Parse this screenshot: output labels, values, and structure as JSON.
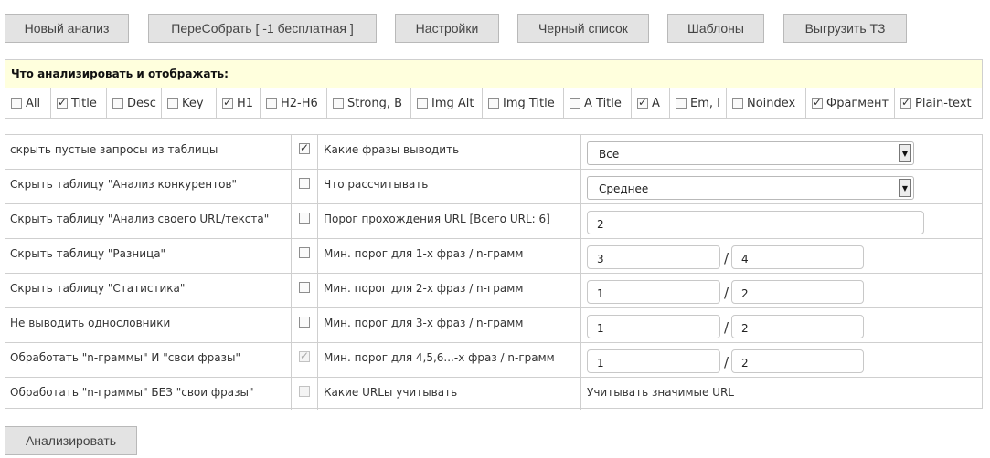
{
  "toolbar": {
    "new_analysis": "Новый анализ",
    "rebuild": "ПереСобрать [ -1 бесплатная ]",
    "settings": "Настройки",
    "blacklist": "Черный список",
    "templates": "Шаблоны",
    "export": "Выгрузить ТЗ"
  },
  "filters": {
    "heading": "Что анализировать и отображать:",
    "items": [
      {
        "label": "All",
        "checked": false
      },
      {
        "label": "Title",
        "checked": true
      },
      {
        "label": "Desc",
        "checked": false
      },
      {
        "label": "Key",
        "checked": false
      },
      {
        "label": "H1",
        "checked": true
      },
      {
        "label": "H2-H6",
        "checked": false
      },
      {
        "label": "Strong, B",
        "checked": false
      },
      {
        "label": "Img Alt",
        "checked": false
      },
      {
        "label": "Img Title",
        "checked": false
      },
      {
        "label": "A Title",
        "checked": false
      },
      {
        "label": "A",
        "checked": true
      },
      {
        "label": "Em, I",
        "checked": false
      },
      {
        "label": "Noindex",
        "checked": false
      },
      {
        "label": "Фрагмент",
        "checked": true
      },
      {
        "label": "Plain-text",
        "checked": true
      }
    ]
  },
  "options": {
    "rows": [
      {
        "label": "скрыть пустые запросы из таблицы",
        "checked": true,
        "disabled": false,
        "setting": "Какие фразы выводить",
        "select": "Все"
      },
      {
        "label": "Скрыть таблицу \"Анализ конкурентов\"",
        "checked": false,
        "disabled": false,
        "setting": "Что рассчитывать",
        "select": "Среднее"
      },
      {
        "label": "Скрыть таблицу \"Анализ своего URL/текста\"",
        "checked": false,
        "disabled": false,
        "setting": "Порог прохождения URL [Всего URL: 6]",
        "input": "2"
      },
      {
        "label": "Скрыть таблицу \"Разница\"",
        "checked": false,
        "disabled": false,
        "setting": "Мин. порог для 1-х фраз / n-грамм",
        "phrases": "3",
        "ngrams": "4"
      },
      {
        "label": "Скрыть таблицу \"Статистика\"",
        "checked": false,
        "disabled": false,
        "setting": "Мин. порог для 2-х фраз / n-грамм",
        "phrases": "1",
        "ngrams": "2"
      },
      {
        "label": "Не выводить однословники",
        "checked": false,
        "disabled": false,
        "setting": "Мин. порог для 3-х фраз / n-грамм",
        "phrases": "1",
        "ngrams": "2"
      },
      {
        "label": "Обработать \"n-граммы\" И \"свои фразы\"",
        "checked": true,
        "disabled": true,
        "setting": "Мин. порог для 4,5,6...-х фраз / n-грамм",
        "phrases": "1",
        "ngrams": "2"
      },
      {
        "label": "Обработать \"n-граммы\" БЕЗ \"свои фразы\"",
        "checked": false,
        "disabled": true,
        "setting": "Какие URLы учитывать",
        "value": "Учитывать значимые URL"
      }
    ],
    "separator": "/"
  },
  "actions": {
    "analyze": "Анализировать"
  }
}
